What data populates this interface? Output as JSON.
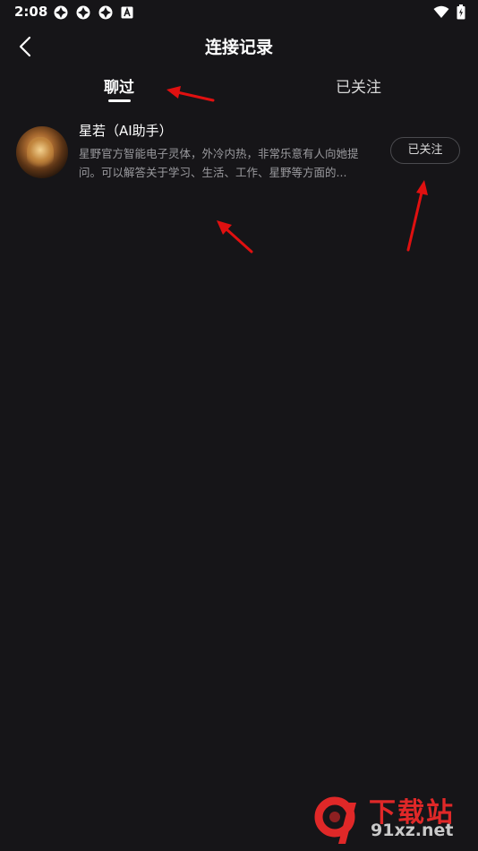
{
  "status_bar": {
    "time": "2:08",
    "left_icons": [
      "app-icon",
      "app-icon",
      "app-icon",
      "a-icon"
    ],
    "right_icons": [
      "wifi-icon",
      "battery-icon"
    ]
  },
  "header": {
    "title": "连接记录"
  },
  "tabs": [
    {
      "label": "聊过",
      "active": true
    },
    {
      "label": "已关注",
      "active": false
    }
  ],
  "list": [
    {
      "name": "星若（AI助手）",
      "description": "星野官方智能电子灵体，外冷内热，非常乐意有人向她提问。可以解答关于学习、生活、工作、星野等方面的...",
      "button_label": "已关注"
    }
  ],
  "watermark": {
    "text_cn": "下载站",
    "url": "91xz.net"
  },
  "colors": {
    "background": "#161518",
    "annotation_arrow": "#e01010",
    "watermark_red": "#e02828"
  }
}
